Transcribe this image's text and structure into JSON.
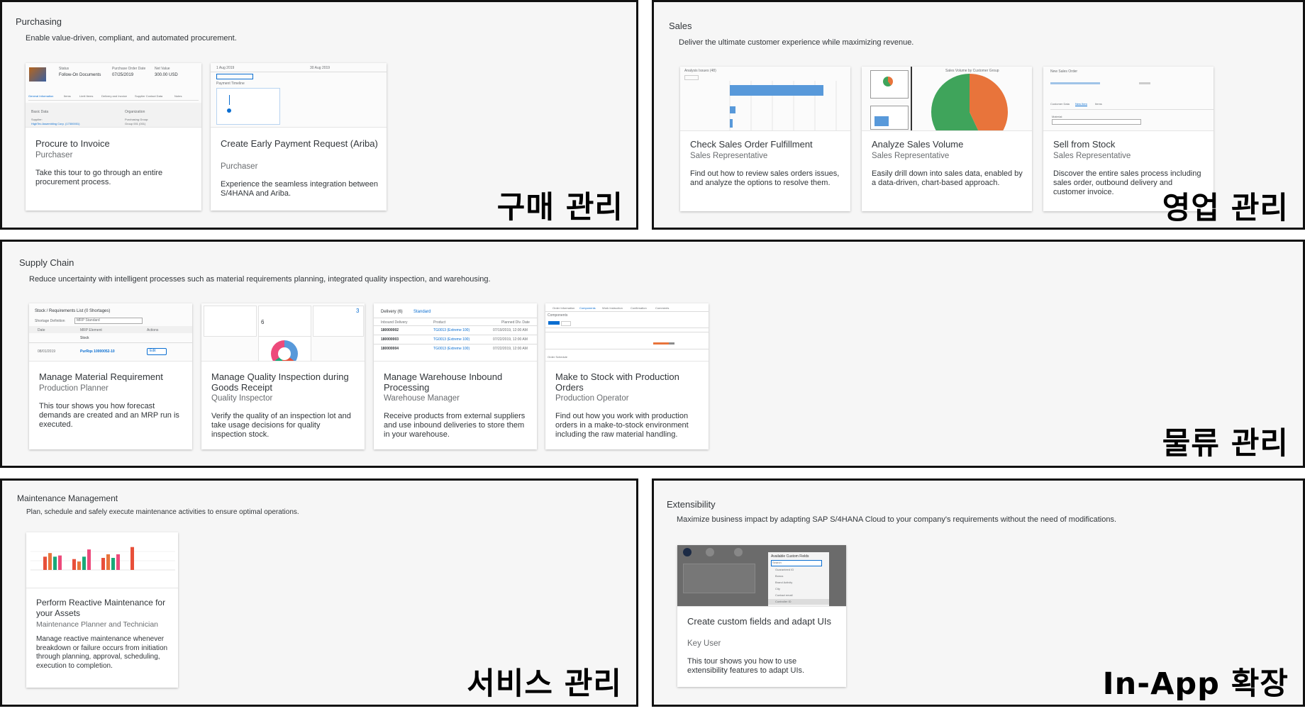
{
  "sections": {
    "purchasing": {
      "title": "Purchasing",
      "subtitle": "Enable value-driven, compliant, and automated procurement.",
      "overlay": "구매 관리",
      "cards": [
        {
          "title": "Procure to Invoice",
          "role": "Purchaser",
          "desc": "Take this tour to go through an entire procurement process.",
          "thumb": {
            "status_label": "Status",
            "status_value": "Follow-On Documents",
            "date_label": "Purchase Order Date",
            "date_value": "07/25/2019",
            "net_label": "Net Value",
            "net_value": "300.00  USD",
            "tabs": [
              "General Information",
              "Items",
              "Limit Items",
              "Delivery and Invoice",
              "Supplier Contact Data",
              "Notes"
            ],
            "basic_data": "Basic Data",
            "organization": "Organization",
            "supplier": "Supplier:",
            "supplier_value": "HighTec Assembling Corp. (17300001)",
            "purchasing_group": "Purchasing Group:",
            "group_value": "Group 001 (001)"
          }
        },
        {
          "title": "Create Early Payment Request (Ariba)",
          "role": "Purchaser",
          "desc": "Experience the seamless integration between S/4HANA and Ariba.",
          "thumb": {
            "header_left": "1 Aug 2019",
            "header_mid": "30 Aug 2019",
            "timeline": "Payment Timeline"
          }
        }
      ]
    },
    "sales": {
      "title": "Sales",
      "subtitle": "Deliver the ultimate customer experience while maximizing revenue.",
      "overlay": "영업 관리",
      "cards": [
        {
          "title": "Check Sales Order Fulfillment",
          "role": "Sales Representative",
          "desc": "Find out how to review sales orders issues, and analyze the options to resolve them.",
          "thumb": {
            "header": "Analysis Issues (48)"
          }
        },
        {
          "title": "Analyze Sales Volume",
          "role": "Sales Representative",
          "desc": "Easily drill down into sales data, enabled by a data-driven, chart-based approach.",
          "thumb": {
            "header": "Sales Volume by Customer Group",
            "pie_share": 0.57
          }
        },
        {
          "title": "Sell from Stock",
          "role": "Sales Representative",
          "desc": "Discover the entire sales process including sales order, outbound delivery and customer invoice.",
          "thumb": {
            "header": "New Sales Order",
            "tabs": [
              "Customer Data",
              "New Item",
              "Items"
            ],
            "material": "Material:"
          }
        }
      ]
    },
    "supply": {
      "title": "Supply Chain",
      "subtitle": "Reduce uncertainty with intelligent processes such as material requirements planning, integrated quality inspection, and warehousing.",
      "overlay": "물류 관리",
      "cards": [
        {
          "title": "Manage Material Requirement",
          "role": "Production Planner",
          "desc": "This tour shows you how forecast demands are created and an MRP run is executed.",
          "thumb": {
            "header": "Stock / Requirements List (0 Shortages)",
            "shortage_label": "Shortage Definition",
            "shortage_value": "MRP Standard",
            "cols": [
              "Date",
              "MRP Element",
              "Actions"
            ],
            "stock": "Stock",
            "row_date": "08/01/2019",
            "row_element": "PurRqs 10000052-10",
            "row_action": "Edit"
          }
        },
        {
          "title": "Manage Quality Inspection during Goods Receipt",
          "role": "Quality Inspector",
          "desc": "Verify the quality of an inspection lot and take usage decisions for quality inspection stock.",
          "thumb": {
            "count_a": "6",
            "count_b": "3"
          }
        },
        {
          "title": "Manage Warehouse Inbound Processing",
          "role": "Warehouse Manager",
          "desc": "Receive products from external suppliers and use inbound deliveries to store them in your warehouse.",
          "thumb": {
            "header": "Delivery (6)",
            "variant": "Standard",
            "cols": [
              "Inbound Delivery",
              "Product",
              "Planned Dlv. Date"
            ],
            "rows": [
              {
                "id": "180000002",
                "product": "TG0013 (Extreme 100)",
                "date": "07/19/2019, 12:00 AM"
              },
              {
                "id": "180000003",
                "product": "TG0013 (Extreme 100)",
                "date": "07/22/2019, 12:00 AM"
              },
              {
                "id": "180000004",
                "product": "TG0013 (Extreme 100)",
                "date": "07/22/2019, 12:00 AM"
              }
            ]
          }
        },
        {
          "title": "Make to Stock with Production Orders",
          "role": "Production Operator",
          "desc": "Find out how you work with production orders in a make-to-stock environment including the raw material handling.",
          "thumb": {
            "tabs": [
              "Order Information",
              "Components",
              "Work Instruction",
              "Confirmation",
              "Comments"
            ],
            "components": "Components",
            "schedule": "Order Schedule"
          }
        }
      ]
    },
    "maintenance": {
      "title": "Maintenance Management",
      "subtitle": "Plan, schedule and safely execute maintenance activities to ensure optimal operations.",
      "overlay": "서비스 관리",
      "cards": [
        {
          "title": "Perform Reactive Maintenance for your Assets",
          "role": "Maintenance Planner and Technician",
          "desc": "Manage reactive maintenance whenever breakdown or failure occurs from initiation through planning, approval, scheduling, execution to completion.",
          "thumb": {
            "bars": [
              0.55,
              0.7,
              0.55,
              0.6,
              0.45,
              0.35,
              0.55,
              0.85,
              0.5,
              0.65,
              0.5,
              0.65,
              0.95
            ]
          }
        }
      ]
    },
    "extensibility": {
      "title": "Extensibility",
      "subtitle": "Maximize business impact by adapting SAP S/4HANA Cloud to your company's requirements without the need of modifications.",
      "overlay": "In-App 확장",
      "cards": [
        {
          "title": "Create custom fields and adapt UIs",
          "role": "Key User",
          "desc": "This tour shows you how to use extensibility features to adapt UIs.",
          "thumb": {
            "panel": "Available Custom Fields",
            "search": "Search",
            "fields": [
              "Guaranteed ID",
              "Bonus",
              "Brand Activity",
              "City",
              "Contact email",
              "Controller ID"
            ]
          }
        }
      ]
    }
  },
  "colors": {
    "accent": "#0a6ed1",
    "bar_blue": "#5899da",
    "pie_green": "#3fa45b",
    "pie_orange": "#e8743b",
    "bar_red": "#e8503a",
    "bar_teal": "#19a979",
    "bar_pink": "#ed4a7b",
    "bar_orange": "#e8743b"
  }
}
